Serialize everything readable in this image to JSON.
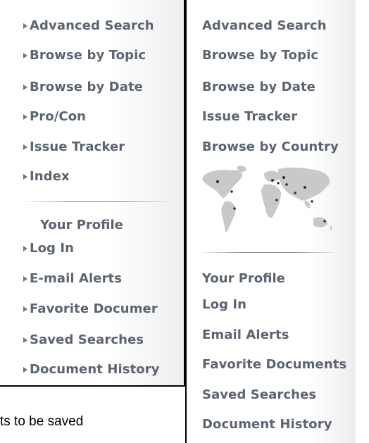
{
  "left_menu": {
    "nav_items": [
      {
        "label": "Advanced Search"
      },
      {
        "label": "Browse by Topic"
      },
      {
        "label": "Browse by Date"
      },
      {
        "label": "Pro/Con"
      },
      {
        "label": "Issue Tracker"
      },
      {
        "label": "Index"
      }
    ],
    "profile_heading": "Your Profile",
    "profile_items": [
      {
        "label": "Log In"
      },
      {
        "label": "E-mail Alerts"
      },
      {
        "label": "Favorite Documer"
      },
      {
        "label": "Saved Searches"
      },
      {
        "label": "Document History"
      }
    ]
  },
  "right_menu": {
    "nav_items": [
      {
        "label": "Advanced Search"
      },
      {
        "label": "Browse by Topic"
      },
      {
        "label": "Browse by Date"
      },
      {
        "label": "Issue Tracker"
      },
      {
        "label": "Browse by Country"
      }
    ],
    "map_icon": "world-map-icon",
    "profile_heading": "Your Profile",
    "profile_items": [
      {
        "label": "Log In"
      },
      {
        "label": "Email Alerts"
      },
      {
        "label": "Favorite Documents"
      },
      {
        "label": "Saved Searches"
      },
      {
        "label": "Document History"
      }
    ]
  },
  "caption": "ts to be saved",
  "colors": {
    "menu_text": "#5c6470",
    "bullet": "#707884",
    "map_land": "#c8c8c8",
    "map_dots": "#333333",
    "border": "#000000"
  }
}
